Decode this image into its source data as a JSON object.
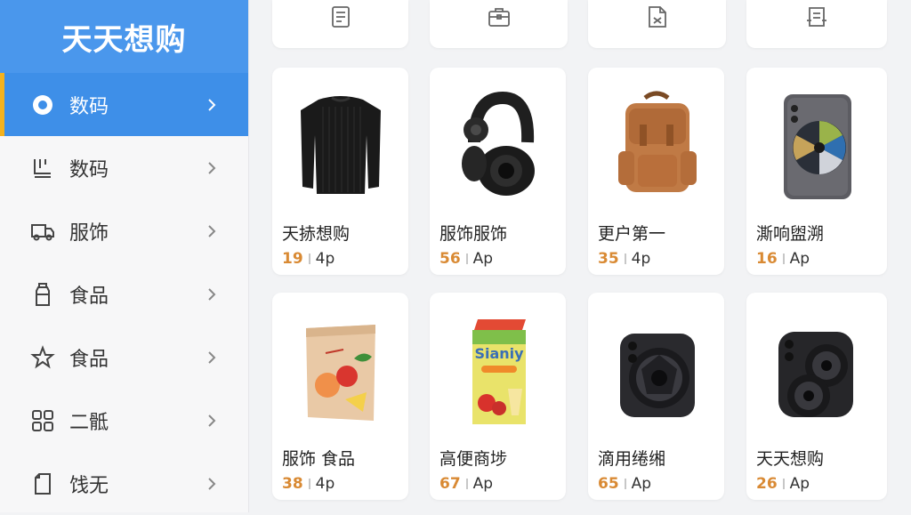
{
  "sidebar": {
    "brand": "天天想购",
    "items": [
      {
        "label": "数码",
        "icon": "radio-circle-icon",
        "active": true
      },
      {
        "label": "数码",
        "icon": "scan-device-icon",
        "active": false
      },
      {
        "label": "服饰",
        "icon": "truck-icon",
        "active": false
      },
      {
        "label": "食品",
        "icon": "bottle-icon",
        "active": false
      },
      {
        "label": "食品",
        "icon": "star-icon",
        "active": false
      },
      {
        "label": "二骶",
        "icon": "grid-icon",
        "active": false
      },
      {
        "label": "饯无",
        "icon": "document-icon",
        "active": false
      }
    ]
  },
  "top_icons": [
    "receipt-icon",
    "briefcase-icon",
    "scan-doc-icon",
    "tag-doc-icon"
  ],
  "products": [
    {
      "name": "天捇想购",
      "price": "19",
      "unit": "4p",
      "image": "black-sweater"
    },
    {
      "name": "服饰服饰",
      "price": "56",
      "unit": "Ap",
      "image": "black-headphones"
    },
    {
      "name": "更户第一",
      "price": "35",
      "unit": "4p",
      "image": "leather-backpack"
    },
    {
      "name": "澌响盥溯",
      "price": "16",
      "unit": "Ap",
      "image": "gray-phone"
    },
    {
      "name": "服饰 食品",
      "price": "38",
      "unit": "4p",
      "image": "snack-bag"
    },
    {
      "name": "高便商埗",
      "price": "67",
      "unit": "Ap",
      "image": "juice-box"
    },
    {
      "name": "滴用绻缃",
      "price": "65",
      "unit": "Ap",
      "image": "black-camera"
    },
    {
      "name": "天天想购",
      "price": "26",
      "unit": "Ap",
      "image": "dual-lens-camera"
    }
  ],
  "juice_box_label": "Sianiy",
  "colors": {
    "brand_blue": "#4a97ec",
    "active_blue": "#3e8fe8",
    "active_marker": "#f4b21e",
    "price": "#d98a34"
  }
}
